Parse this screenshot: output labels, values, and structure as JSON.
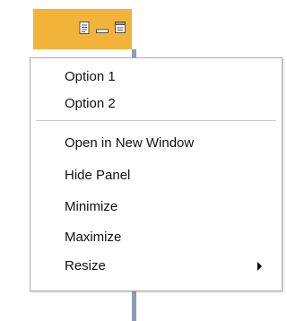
{
  "toolbar": {
    "icons": [
      "document-icon",
      "minimize-icon",
      "window-icon"
    ],
    "accent": "#f2b33a",
    "panel_edge": "#8e9cb4"
  },
  "menu": {
    "items": [
      {
        "label": "Option 1"
      },
      {
        "label": "Option 2"
      },
      {
        "label": "Open in New Window"
      },
      {
        "label": "Hide Panel"
      },
      {
        "label": "Minimize"
      },
      {
        "label": "Maximize"
      },
      {
        "label": "Resize",
        "submenu_icon": "chevron-right-icon"
      }
    ]
  }
}
